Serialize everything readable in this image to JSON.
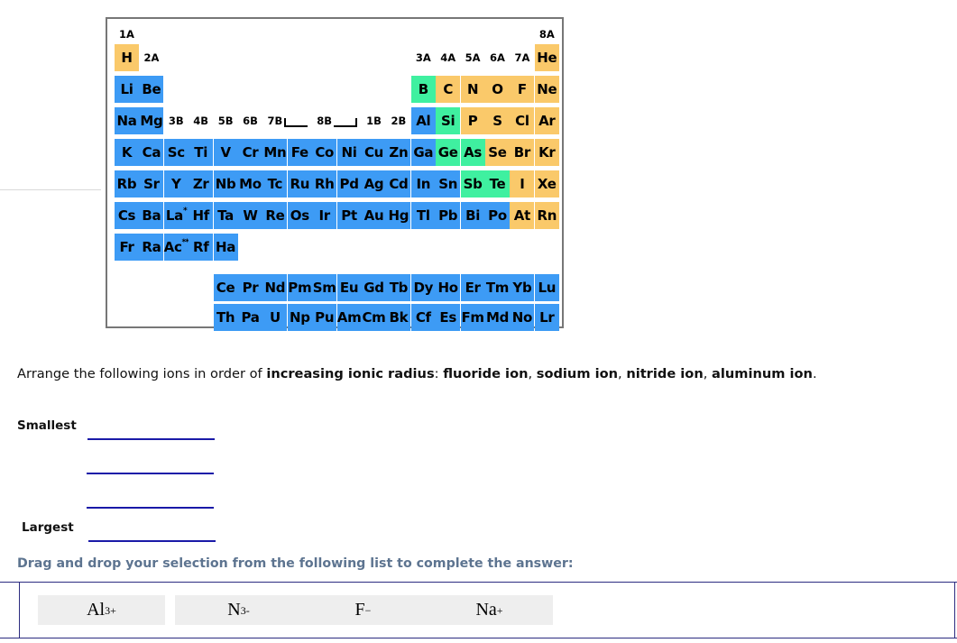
{
  "periodic_table": {
    "group_labels": [
      {
        "text": "1A",
        "col": 1,
        "row": 0
      },
      {
        "text": "2A",
        "col": 2,
        "row": 1
      },
      {
        "text": "3B",
        "col": 3,
        "row": 3
      },
      {
        "text": "4B",
        "col": 4,
        "row": 3
      },
      {
        "text": "5B",
        "col": 5,
        "row": 3
      },
      {
        "text": "6B",
        "col": 6,
        "row": 3
      },
      {
        "text": "7B",
        "col": 7,
        "row": 3
      },
      {
        "text": "8B",
        "col": 9,
        "row": 3
      },
      {
        "text": "1B",
        "col": 11,
        "row": 3
      },
      {
        "text": "2B",
        "col": 12,
        "row": 3
      },
      {
        "text": "3A",
        "col": 13,
        "row": 1
      },
      {
        "text": "4A",
        "col": 14,
        "row": 1
      },
      {
        "text": "5A",
        "col": 15,
        "row": 1
      },
      {
        "text": "6A",
        "col": 16,
        "row": 1
      },
      {
        "text": "7A",
        "col": 17,
        "row": 1
      },
      {
        "text": "8A",
        "col": 18,
        "row": 0
      }
    ],
    "elements": [
      {
        "sym": "H",
        "col": 1,
        "row": 1,
        "type": "nonmetal"
      },
      {
        "sym": "He",
        "col": 18,
        "row": 1,
        "type": "nonmetal"
      },
      {
        "sym": "Li",
        "col": 1,
        "row": 2,
        "type": "metal"
      },
      {
        "sym": "Be",
        "col": 2,
        "row": 2,
        "type": "metal"
      },
      {
        "sym": "B",
        "col": 13,
        "row": 2,
        "type": "metalloid"
      },
      {
        "sym": "C",
        "col": 14,
        "row": 2,
        "type": "nonmetal"
      },
      {
        "sym": "N",
        "col": 15,
        "row": 2,
        "type": "nonmetal"
      },
      {
        "sym": "O",
        "col": 16,
        "row": 2,
        "type": "nonmetal"
      },
      {
        "sym": "F",
        "col": 17,
        "row": 2,
        "type": "nonmetal"
      },
      {
        "sym": "Ne",
        "col": 18,
        "row": 2,
        "type": "nonmetal"
      },
      {
        "sym": "Na",
        "col": 1,
        "row": 3,
        "type": "metal"
      },
      {
        "sym": "Mg",
        "col": 2,
        "row": 3,
        "type": "metal"
      },
      {
        "sym": "Al",
        "col": 13,
        "row": 3,
        "type": "metal"
      },
      {
        "sym": "Si",
        "col": 14,
        "row": 3,
        "type": "metalloid"
      },
      {
        "sym": "P",
        "col": 15,
        "row": 3,
        "type": "nonmetal"
      },
      {
        "sym": "S",
        "col": 16,
        "row": 3,
        "type": "nonmetal"
      },
      {
        "sym": "Cl",
        "col": 17,
        "row": 3,
        "type": "nonmetal"
      },
      {
        "sym": "Ar",
        "col": 18,
        "row": 3,
        "type": "nonmetal"
      },
      {
        "sym": "K",
        "col": 1,
        "row": 4,
        "type": "metal"
      },
      {
        "sym": "Ca",
        "col": 2,
        "row": 4,
        "type": "metal"
      },
      {
        "sym": "Sc",
        "col": 3,
        "row": 4,
        "type": "metal"
      },
      {
        "sym": "Ti",
        "col": 4,
        "row": 4,
        "type": "metal"
      },
      {
        "sym": "V",
        "col": 5,
        "row": 4,
        "type": "metal"
      },
      {
        "sym": "Cr",
        "col": 6,
        "row": 4,
        "type": "metal"
      },
      {
        "sym": "Mn",
        "col": 7,
        "row": 4,
        "type": "metal"
      },
      {
        "sym": "Fe",
        "col": 8,
        "row": 4,
        "type": "metal"
      },
      {
        "sym": "Co",
        "col": 9,
        "row": 4,
        "type": "metal"
      },
      {
        "sym": "Ni",
        "col": 10,
        "row": 4,
        "type": "metal"
      },
      {
        "sym": "Cu",
        "col": 11,
        "row": 4,
        "type": "metal"
      },
      {
        "sym": "Zn",
        "col": 12,
        "row": 4,
        "type": "metal"
      },
      {
        "sym": "Ga",
        "col": 13,
        "row": 4,
        "type": "metal"
      },
      {
        "sym": "Ge",
        "col": 14,
        "row": 4,
        "type": "metalloid"
      },
      {
        "sym": "As",
        "col": 15,
        "row": 4,
        "type": "metalloid"
      },
      {
        "sym": "Se",
        "col": 16,
        "row": 4,
        "type": "nonmetal"
      },
      {
        "sym": "Br",
        "col": 17,
        "row": 4,
        "type": "nonmetal"
      },
      {
        "sym": "Kr",
        "col": 18,
        "row": 4,
        "type": "nonmetal"
      },
      {
        "sym": "Rb",
        "col": 1,
        "row": 5,
        "type": "metal"
      },
      {
        "sym": "Sr",
        "col": 2,
        "row": 5,
        "type": "metal"
      },
      {
        "sym": "Y",
        "col": 3,
        "row": 5,
        "type": "metal"
      },
      {
        "sym": "Zr",
        "col": 4,
        "row": 5,
        "type": "metal"
      },
      {
        "sym": "Nb",
        "col": 5,
        "row": 5,
        "type": "metal"
      },
      {
        "sym": "Mo",
        "col": 6,
        "row": 5,
        "type": "metal"
      },
      {
        "sym": "Tc",
        "col": 7,
        "row": 5,
        "type": "metal"
      },
      {
        "sym": "Ru",
        "col": 8,
        "row": 5,
        "type": "metal"
      },
      {
        "sym": "Rh",
        "col": 9,
        "row": 5,
        "type": "metal"
      },
      {
        "sym": "Pd",
        "col": 10,
        "row": 5,
        "type": "metal"
      },
      {
        "sym": "Ag",
        "col": 11,
        "row": 5,
        "type": "metal"
      },
      {
        "sym": "Cd",
        "col": 12,
        "row": 5,
        "type": "metal"
      },
      {
        "sym": "In",
        "col": 13,
        "row": 5,
        "type": "metal"
      },
      {
        "sym": "Sn",
        "col": 14,
        "row": 5,
        "type": "metal"
      },
      {
        "sym": "Sb",
        "col": 15,
        "row": 5,
        "type": "metalloid"
      },
      {
        "sym": "Te",
        "col": 16,
        "row": 5,
        "type": "metalloid"
      },
      {
        "sym": "I",
        "col": 17,
        "row": 5,
        "type": "nonmetal"
      },
      {
        "sym": "Xe",
        "col": 18,
        "row": 5,
        "type": "nonmetal"
      },
      {
        "sym": "Cs",
        "col": 1,
        "row": 6,
        "type": "metal"
      },
      {
        "sym": "Ba",
        "col": 2,
        "row": 6,
        "type": "metal"
      },
      {
        "sym": "La",
        "col": 3,
        "row": 6,
        "type": "metal",
        "sup": "*"
      },
      {
        "sym": "Hf",
        "col": 4,
        "row": 6,
        "type": "metal"
      },
      {
        "sym": "Ta",
        "col": 5,
        "row": 6,
        "type": "metal"
      },
      {
        "sym": "W",
        "col": 6,
        "row": 6,
        "type": "metal"
      },
      {
        "sym": "Re",
        "col": 7,
        "row": 6,
        "type": "metal"
      },
      {
        "sym": "Os",
        "col": 8,
        "row": 6,
        "type": "metal"
      },
      {
        "sym": "Ir",
        "col": 9,
        "row": 6,
        "type": "metal"
      },
      {
        "sym": "Pt",
        "col": 10,
        "row": 6,
        "type": "metal"
      },
      {
        "sym": "Au",
        "col": 11,
        "row": 6,
        "type": "metal"
      },
      {
        "sym": "Hg",
        "col": 12,
        "row": 6,
        "type": "metal"
      },
      {
        "sym": "Tl",
        "col": 13,
        "row": 6,
        "type": "metal"
      },
      {
        "sym": "Pb",
        "col": 14,
        "row": 6,
        "type": "metal"
      },
      {
        "sym": "Bi",
        "col": 15,
        "row": 6,
        "type": "metal"
      },
      {
        "sym": "Po",
        "col": 16,
        "row": 6,
        "type": "metal"
      },
      {
        "sym": "At",
        "col": 17,
        "row": 6,
        "type": "nonmetal"
      },
      {
        "sym": "Rn",
        "col": 18,
        "row": 6,
        "type": "nonmetal"
      },
      {
        "sym": "Fr",
        "col": 1,
        "row": 7,
        "type": "metal"
      },
      {
        "sym": "Ra",
        "col": 2,
        "row": 7,
        "type": "metal"
      },
      {
        "sym": "Ac",
        "col": 3,
        "row": 7,
        "type": "metal",
        "sup": "**"
      },
      {
        "sym": "Rf",
        "col": 4,
        "row": 7,
        "type": "metal"
      },
      {
        "sym": "Ha",
        "col": 5,
        "row": 7,
        "type": "metal"
      },
      {
        "sym": "Ce",
        "col": 5,
        "row": 9,
        "type": "metal"
      },
      {
        "sym": "Pr",
        "col": 6,
        "row": 9,
        "type": "metal"
      },
      {
        "sym": "Nd",
        "col": 7,
        "row": 9,
        "type": "metal"
      },
      {
        "sym": "Pm",
        "col": 8,
        "row": 9,
        "type": "metal"
      },
      {
        "sym": "Sm",
        "col": 9,
        "row": 9,
        "type": "metal"
      },
      {
        "sym": "Eu",
        "col": 10,
        "row": 9,
        "type": "metal"
      },
      {
        "sym": "Gd",
        "col": 11,
        "row": 9,
        "type": "metal"
      },
      {
        "sym": "Tb",
        "col": 12,
        "row": 9,
        "type": "metal"
      },
      {
        "sym": "Dy",
        "col": 13,
        "row": 9,
        "type": "metal"
      },
      {
        "sym": "Ho",
        "col": 14,
        "row": 9,
        "type": "metal"
      },
      {
        "sym": "Er",
        "col": 15,
        "row": 9,
        "type": "metal"
      },
      {
        "sym": "Tm",
        "col": 16,
        "row": 9,
        "type": "metal"
      },
      {
        "sym": "Yb",
        "col": 17,
        "row": 9,
        "type": "metal"
      },
      {
        "sym": "Lu",
        "col": 18,
        "row": 9,
        "type": "metal"
      },
      {
        "sym": "Th",
        "col": 5,
        "row": 10,
        "type": "metal"
      },
      {
        "sym": "Pa",
        "col": 6,
        "row": 10,
        "type": "metal"
      },
      {
        "sym": "U",
        "col": 7,
        "row": 10,
        "type": "metal"
      },
      {
        "sym": "Np",
        "col": 8,
        "row": 10,
        "type": "metal"
      },
      {
        "sym": "Pu",
        "col": 9,
        "row": 10,
        "type": "metal"
      },
      {
        "sym": "Am",
        "col": 10,
        "row": 10,
        "type": "metal"
      },
      {
        "sym": "Cm",
        "col": 11,
        "row": 10,
        "type": "metal"
      },
      {
        "sym": "Bk",
        "col": 12,
        "row": 10,
        "type": "metal"
      },
      {
        "sym": "Cf",
        "col": 13,
        "row": 10,
        "type": "metal"
      },
      {
        "sym": "Es",
        "col": 14,
        "row": 10,
        "type": "metal"
      },
      {
        "sym": "Fm",
        "col": 15,
        "row": 10,
        "type": "metal"
      },
      {
        "sym": "Md",
        "col": 16,
        "row": 10,
        "type": "metal"
      },
      {
        "sym": "No",
        "col": 17,
        "row": 10,
        "type": "metal"
      },
      {
        "sym": "Lr",
        "col": 18,
        "row": 10,
        "type": "metal"
      }
    ],
    "colors": {
      "metal": "#3d9bf5",
      "nonmetal": "#fac96a",
      "metalloid": "#3ff0a0",
      "border": "#777777"
    }
  },
  "question": {
    "prefix": "Arrange the following ions in order of ",
    "emphasis": "increasing ionic radius",
    "colon": ": ",
    "ions": [
      "fluoride ion",
      "sodium ion",
      "nitride ion",
      "aluminum ion"
    ],
    "separator": ", ",
    "period": "."
  },
  "answer": {
    "smallest_label": "Smallest",
    "largest_label": "Largest",
    "blank_count": 4,
    "blank_color": "#1a1aa8"
  },
  "drag_drop": {
    "instruction": "Drag and drop your selection from the following list to complete the answer:",
    "instruction_color": "#5d7490",
    "border_color": "#2b2b80",
    "tokens": [
      {
        "base": "Al",
        "charge": "3+"
      },
      {
        "base": "N",
        "charge": "3-"
      },
      {
        "base": "F",
        "charge": "−"
      },
      {
        "base": "Na",
        "charge": "+"
      }
    ]
  }
}
